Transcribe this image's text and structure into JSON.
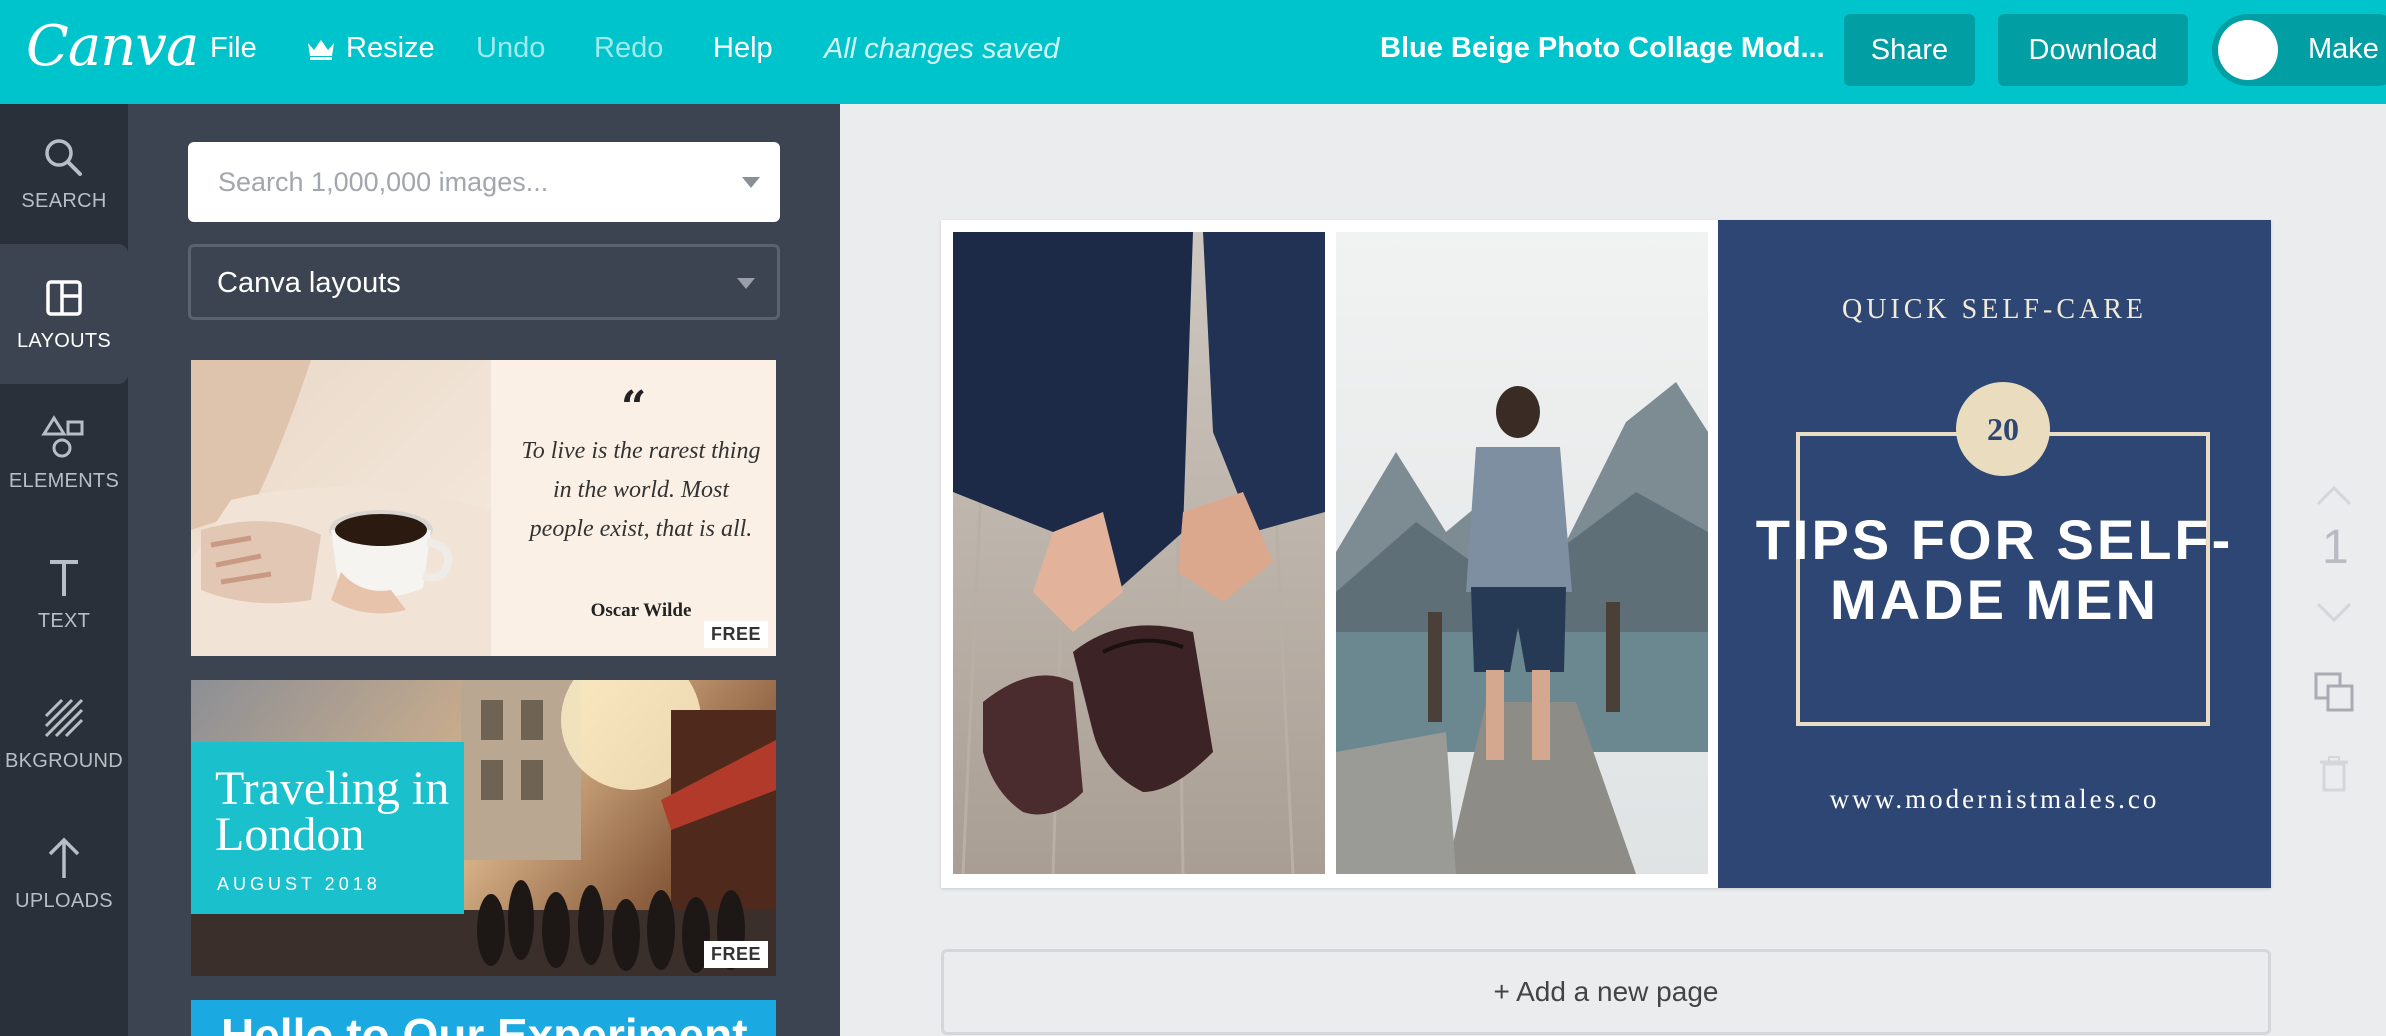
{
  "topbar": {
    "logo": "Canva",
    "menu": {
      "file": "File",
      "resize": "Resize",
      "undo": "Undo",
      "redo": "Redo",
      "help": "Help"
    },
    "status": "All changes saved",
    "doc_title": "Blue Beige Photo Collage Mod...",
    "share": "Share",
    "download": "Download",
    "make_public": "Make"
  },
  "rail": {
    "items": [
      {
        "label": "SEARCH",
        "icon": "search-icon",
        "active": false
      },
      {
        "label": "LAYOUTS",
        "icon": "layouts-icon",
        "active": true
      },
      {
        "label": "ELEMENTS",
        "icon": "elements-icon",
        "active": false
      },
      {
        "label": "TEXT",
        "icon": "text-icon",
        "active": false
      },
      {
        "label": "BKGROUND",
        "icon": "background-icon",
        "active": false
      },
      {
        "label": "UPLOADS",
        "icon": "upload-icon",
        "active": false
      }
    ]
  },
  "panel": {
    "search_placeholder": "Search 1,000,000 images...",
    "layout_select": "Canva layouts",
    "thumbs": [
      {
        "quote_mark": "“",
        "quote_lines": "To live is the rarest thing in the world. Most people exist, that is all.",
        "author": "Oscar Wilde",
        "badge": "FREE"
      },
      {
        "title": "Traveling in London",
        "subtitle": "AUGUST 2018",
        "badge": "FREE"
      },
      {
        "title": "Hello to Our Experiment"
      }
    ]
  },
  "canvas": {
    "kicker": "QUICK SELF-CARE",
    "number": "20",
    "headline": "TIPS FOR SELF-MADE MEN",
    "url": "www.modernistmales.co",
    "add_page": "+ Add a new page",
    "page_number": "1"
  },
  "colors": {
    "brand": "#00c4cc",
    "brand_dark": "#019ea4",
    "panel": "#3d4451",
    "rail": "#293039",
    "navy": "#2d4674",
    "beige": "#eadcbe"
  }
}
